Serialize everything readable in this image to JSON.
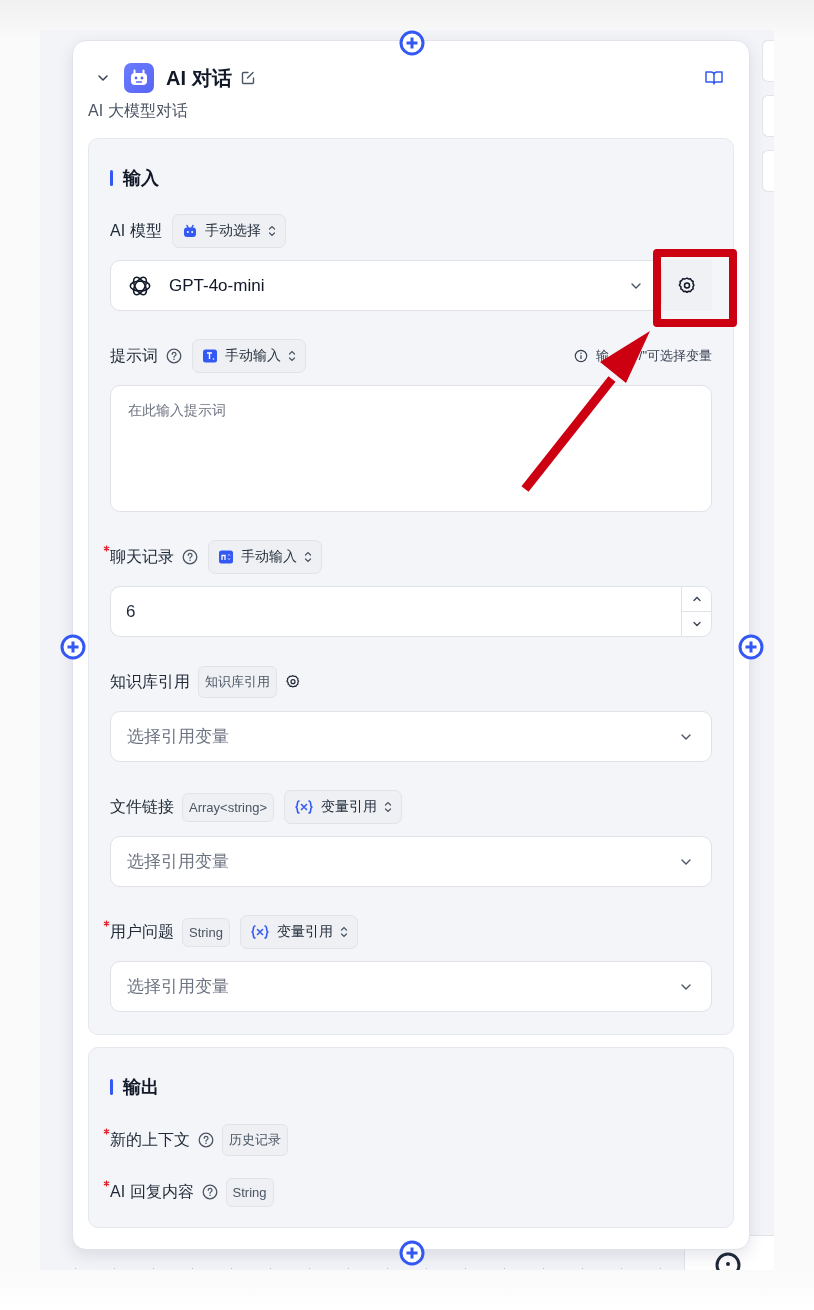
{
  "node": {
    "title": "AI 对话",
    "description": "AI 大模型对话"
  },
  "input_section": {
    "title": "输入",
    "fields": [
      {
        "kind": "model",
        "label": "AI 模型",
        "required": false,
        "help": false,
        "mode": {
          "label": "手动选择",
          "kind": "model"
        },
        "value": "GPT-4o-mini"
      },
      {
        "kind": "textarea",
        "label": "提示词",
        "required": false,
        "help": true,
        "mode": {
          "label": "手动输入",
          "kind": "text"
        },
        "hint": [
          "输",
          "/\"可选择变量"
        ],
        "placeholder": "在此输入提示词"
      },
      {
        "kind": "number",
        "label": "聊天记录",
        "required": true,
        "help": true,
        "mode": {
          "label": "手动输入",
          "kind": "number"
        },
        "value": "6"
      },
      {
        "kind": "select",
        "label": "知识库引用",
        "required": false,
        "help": false,
        "type_tag": "知识库引用",
        "settings": true,
        "placeholder": "选择引用变量"
      },
      {
        "kind": "select",
        "label": "文件链接",
        "required": false,
        "help": false,
        "type_tag": "Array<string>",
        "mode": {
          "label": "变量引用",
          "kind": "variable"
        },
        "placeholder": "选择引用变量"
      },
      {
        "kind": "select",
        "label": "用户问题",
        "required": true,
        "help": false,
        "type_tag": "String",
        "mode": {
          "label": "变量引用",
          "kind": "variable"
        },
        "placeholder": "选择引用变量"
      }
    ]
  },
  "output_section": {
    "title": "输出",
    "fields": [
      {
        "label": "新的上下文",
        "required": true,
        "help": true,
        "type_tag": "历史记录"
      },
      {
        "label": "AI 回复内容",
        "required": true,
        "help": true,
        "type_tag": "String"
      }
    ]
  }
}
